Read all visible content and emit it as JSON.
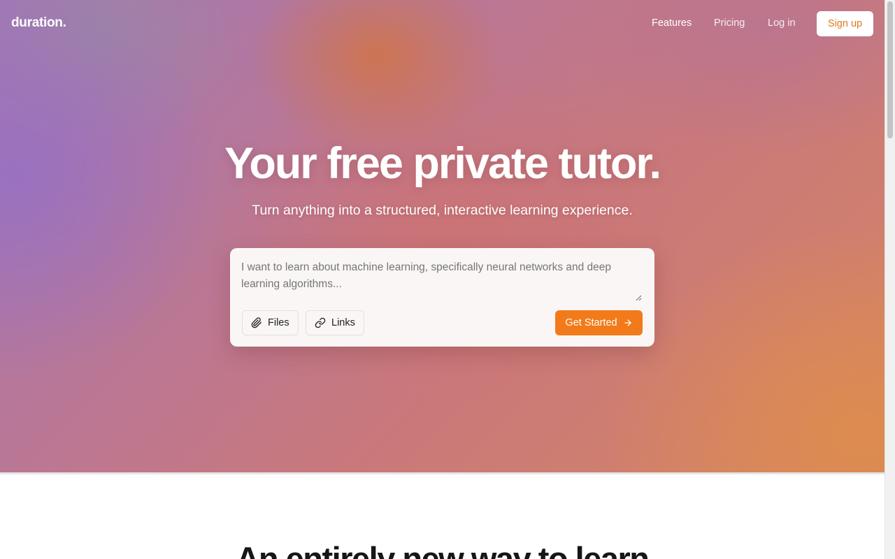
{
  "nav": {
    "logo": "duration.",
    "links": [
      "Features",
      "Pricing",
      "Log in"
    ],
    "signup_label": "Sign up"
  },
  "hero": {
    "title": "Your free private tutor.",
    "subtitle": "Turn anything into a structured, interactive learning experience."
  },
  "prompt": {
    "placeholder": "I want to learn about machine learning, specifically neural networks and deep learning algorithms...",
    "files_label": "Files",
    "links_label": "Links",
    "submit_label": "Get Started"
  },
  "section": {
    "title": "An entirely new way to learn"
  },
  "icons": {
    "attach": "paperclip-icon",
    "link": "link-icon",
    "submit": "arrow-right-icon"
  },
  "colors": {
    "accent": "#f27a1a",
    "signup_text": "#e07a1f",
    "card_bg": "#faf6f5"
  }
}
